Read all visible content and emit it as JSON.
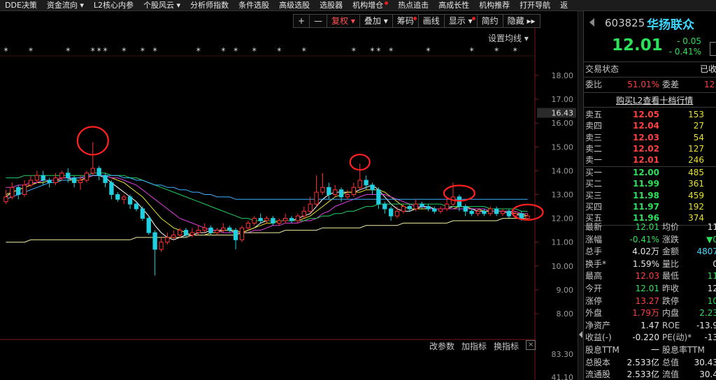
{
  "menu": [
    {
      "label": "DDE决策",
      "has_dropdown": false,
      "dot": false
    },
    {
      "label": "资金流向",
      "has_dropdown": true,
      "dot": false
    },
    {
      "label": "L2核心内参",
      "has_dropdown": false,
      "dot": false
    },
    {
      "label": "个股风云",
      "has_dropdown": true,
      "dot": false
    },
    {
      "label": "分析师指数",
      "has_dropdown": false,
      "dot": false
    },
    {
      "label": "条件选股",
      "has_dropdown": false,
      "dot": false
    },
    {
      "label": "高级选股",
      "has_dropdown": false,
      "dot": false
    },
    {
      "label": "选股器",
      "has_dropdown": false,
      "dot": false
    },
    {
      "label": "机构增仓",
      "has_dropdown": false,
      "dot": true
    },
    {
      "label": "热点追击",
      "has_dropdown": false,
      "dot": false
    },
    {
      "label": "高成长性",
      "has_dropdown": false,
      "dot": false
    },
    {
      "label": "机构推荐",
      "has_dropdown": false,
      "dot": false
    },
    {
      "label": "打开导航",
      "has_dropdown": false,
      "dot": false
    },
    {
      "label": "返",
      "has_dropdown": false,
      "dot": false
    }
  ],
  "toolbar": [
    {
      "label": "+",
      "active": false,
      "dot": false
    },
    {
      "label": "—",
      "active": false,
      "dot": false
    },
    {
      "label": "复权 ▾",
      "active": true,
      "dot": false
    },
    {
      "label": "叠加 ▾",
      "active": false,
      "dot": false
    },
    {
      "label": "筹码",
      "active": false,
      "dot": true
    },
    {
      "label": "画线",
      "active": false,
      "dot": false
    },
    {
      "label": "显示 ▾",
      "active": false,
      "dot": true
    },
    {
      "label": "简约",
      "active": false,
      "dot": false
    },
    {
      "label": "隐藏 ▸▸",
      "active": false,
      "dot": false
    }
  ],
  "ma_setting_label": "设置均线 ▾",
  "indicator_bar": {
    "params": "改参数",
    "add": "加指标",
    "switch": "换指标",
    "close": "×"
  },
  "chart_data": {
    "type": "candlestick",
    "y_ticks": [
      "18.00",
      "17.00",
      "16.00",
      "15.00",
      "14.00",
      "13.00",
      "12.00",
      "11.00",
      "10.00",
      "9.00",
      "8.00"
    ],
    "current_price_label": "16.43",
    "volume_ticks": [
      "83.30",
      "41.10"
    ],
    "ylim": [
      7.5,
      18.5
    ],
    "candles": [
      [
        12.7,
        12.9,
        13.2,
        12.6
      ],
      [
        12.9,
        13.3,
        13.5,
        12.8
      ],
      [
        13.3,
        13.0,
        13.4,
        12.8
      ],
      [
        13.0,
        13.4,
        13.6,
        12.9
      ],
      [
        13.4,
        13.6,
        13.8,
        13.3
      ],
      [
        13.6,
        13.8,
        14.0,
        13.5
      ],
      [
        13.8,
        13.6,
        14.0,
        13.4
      ],
      [
        13.6,
        13.5,
        13.7,
        13.3
      ],
      [
        13.5,
        13.7,
        13.9,
        13.4
      ],
      [
        13.7,
        13.9,
        14.0,
        13.6
      ],
      [
        13.9,
        13.7,
        14.1,
        13.5
      ],
      [
        13.7,
        13.5,
        13.8,
        13.3
      ],
      [
        13.5,
        13.6,
        13.8,
        13.2
      ],
      [
        13.6,
        13.9,
        14.0,
        13.5
      ],
      [
        13.9,
        14.1,
        15.2,
        13.8
      ],
      [
        14.1,
        13.8,
        14.2,
        13.6
      ],
      [
        13.8,
        13.5,
        13.9,
        13.3
      ],
      [
        13.5,
        13.0,
        13.6,
        12.8
      ],
      [
        13.0,
        12.8,
        13.1,
        12.7
      ],
      [
        12.8,
        12.9,
        13.0,
        12.6
      ],
      [
        12.9,
        12.6,
        13.0,
        12.4
      ],
      [
        12.6,
        12.4,
        12.7,
        12.3
      ],
      [
        12.4,
        12.0,
        12.5,
        11.9
      ],
      [
        12.0,
        11.4,
        12.1,
        11.3
      ],
      [
        11.4,
        10.7,
        11.5,
        9.6
      ],
      [
        10.7,
        11.0,
        11.2,
        10.6
      ],
      [
        11.0,
        11.2,
        11.4,
        10.9
      ],
      [
        11.2,
        11.3,
        11.5,
        11.1
      ],
      [
        11.3,
        11.5,
        11.6,
        11.2
      ],
      [
        11.5,
        11.3,
        11.6,
        11.2
      ],
      [
        11.3,
        11.4,
        11.6,
        11.2
      ],
      [
        11.4,
        11.5,
        11.7,
        11.3
      ],
      [
        11.5,
        11.6,
        11.8,
        11.4
      ],
      [
        11.6,
        11.4,
        11.7,
        11.3
      ],
      [
        11.4,
        11.5,
        11.6,
        11.3
      ],
      [
        11.5,
        11.6,
        11.8,
        11.4
      ],
      [
        11.6,
        11.5,
        11.7,
        11.4
      ],
      [
        11.5,
        11.1,
        11.6,
        10.7
      ],
      [
        11.1,
        11.6,
        11.7,
        11.0
      ],
      [
        11.6,
        11.8,
        11.9,
        11.5
      ],
      [
        11.8,
        12.0,
        12.1,
        11.7
      ],
      [
        12.0,
        11.9,
        12.2,
        11.8
      ],
      [
        11.9,
        12.0,
        12.1,
        11.8
      ],
      [
        12.0,
        11.8,
        12.1,
        11.7
      ],
      [
        11.8,
        11.9,
        12.0,
        11.7
      ],
      [
        11.9,
        12.0,
        12.2,
        11.8
      ],
      [
        12.0,
        11.9,
        12.1,
        11.8
      ],
      [
        11.9,
        12.1,
        12.2,
        11.8
      ],
      [
        12.1,
        12.3,
        12.5,
        12.0
      ],
      [
        12.3,
        12.6,
        12.9,
        12.2
      ],
      [
        12.6,
        13.1,
        13.8,
        12.5
      ],
      [
        13.1,
        13.3,
        13.9,
        13.0
      ],
      [
        13.3,
        13.0,
        13.5,
        12.8
      ],
      [
        13.0,
        13.2,
        13.4,
        12.9
      ],
      [
        13.2,
        12.9,
        13.3,
        12.7
      ],
      [
        12.9,
        13.0,
        13.2,
        12.8
      ],
      [
        13.0,
        13.3,
        13.5,
        12.9
      ],
      [
        13.3,
        13.6,
        14.3,
        13.2
      ],
      [
        13.6,
        13.4,
        13.8,
        13.2
      ],
      [
        13.4,
        13.2,
        13.5,
        13.0
      ],
      [
        13.2,
        12.6,
        13.3,
        12.4
      ],
      [
        12.6,
        12.4,
        12.7,
        12.2
      ],
      [
        12.4,
        12.1,
        12.5,
        11.9
      ],
      [
        12.1,
        12.3,
        12.5,
        12.0
      ],
      [
        12.3,
        12.5,
        12.6,
        12.2
      ],
      [
        12.5,
        12.4,
        12.6,
        12.3
      ],
      [
        12.4,
        12.6,
        12.8,
        12.3
      ],
      [
        12.6,
        12.5,
        12.7,
        12.4
      ],
      [
        12.5,
        12.4,
        12.6,
        12.3
      ],
      [
        12.4,
        12.3,
        12.5,
        12.2
      ],
      [
        12.3,
        12.4,
        12.5,
        12.2
      ],
      [
        12.4,
        12.6,
        12.9,
        12.3
      ],
      [
        12.6,
        12.9,
        13.5,
        12.5
      ],
      [
        12.9,
        12.5,
        13.0,
        12.3
      ],
      [
        12.5,
        12.3,
        12.6,
        12.1
      ],
      [
        12.3,
        12.2,
        12.4,
        12.1
      ],
      [
        12.2,
        12.3,
        12.4,
        12.1
      ],
      [
        12.3,
        12.2,
        12.4,
        12.1
      ],
      [
        12.2,
        12.4,
        12.5,
        12.1
      ],
      [
        12.4,
        12.2,
        12.5,
        12.1
      ],
      [
        12.2,
        12.3,
        12.4,
        12.1
      ],
      [
        12.3,
        12.1,
        12.4,
        12.0
      ],
      [
        12.1,
        12.2,
        12.3,
        12.0
      ],
      [
        12.2,
        12.0,
        12.3,
        11.9
      ],
      [
        12.0,
        12.1,
        12.2,
        11.95
      ]
    ],
    "ma_series": [
      {
        "color": "#ffffff",
        "values": [
          12.9,
          13.1,
          13.2,
          13.3,
          13.4,
          13.5,
          13.6,
          13.6,
          13.6,
          13.7,
          13.7,
          13.6,
          13.6,
          13.7,
          13.8,
          13.8,
          13.7,
          13.5,
          13.3,
          13.1,
          12.9,
          12.7,
          12.4,
          12.1,
          11.7,
          11.4,
          11.2,
          11.1,
          11.2,
          11.3,
          11.3,
          11.4,
          11.4,
          11.5,
          11.5,
          11.5,
          11.5,
          11.4,
          11.4,
          11.5,
          11.6,
          11.8,
          11.9,
          11.9,
          11.9,
          11.9,
          11.9,
          12.0,
          12.1,
          12.2,
          12.5,
          12.8,
          13.0,
          13.1,
          13.1,
          13.1,
          13.1,
          13.2,
          13.3,
          13.4,
          13.2,
          12.9,
          12.6,
          12.4,
          12.3,
          12.3,
          12.4,
          12.5,
          12.5,
          12.4,
          12.4,
          12.4,
          12.5,
          12.5,
          12.5,
          12.4,
          12.3,
          12.3,
          12.3,
          12.3,
          12.3,
          12.2,
          12.2,
          12.1,
          12.1
        ]
      },
      {
        "color": "#e8e030",
        "values": [
          13.0,
          13.1,
          13.2,
          13.3,
          13.4,
          13.5,
          13.5,
          13.6,
          13.6,
          13.6,
          13.6,
          13.6,
          13.6,
          13.7,
          13.8,
          13.8,
          13.8,
          13.7,
          13.6,
          13.5,
          13.3,
          13.1,
          12.9,
          12.6,
          12.3,
          12.0,
          11.8,
          11.6,
          11.5,
          11.4,
          11.3,
          11.3,
          11.3,
          11.4,
          11.4,
          11.5,
          11.5,
          11.5,
          11.4,
          11.5,
          11.6,
          11.7,
          11.8,
          11.8,
          11.9,
          11.9,
          11.9,
          11.9,
          12.0,
          12.1,
          12.3,
          12.5,
          12.7,
          12.9,
          13.0,
          13.1,
          13.1,
          13.1,
          13.2,
          13.2,
          13.2,
          13.1,
          12.9,
          12.7,
          12.5,
          12.4,
          12.4,
          12.4,
          12.4,
          12.4,
          12.4,
          12.4,
          12.4,
          12.5,
          12.5,
          12.4,
          12.4,
          12.3,
          12.3,
          12.3,
          12.3,
          12.3,
          12.2,
          12.2,
          12.1
        ]
      },
      {
        "color": "#e040e0",
        "values": [
          13.3,
          13.3,
          13.4,
          13.4,
          13.5,
          13.5,
          13.6,
          13.6,
          13.6,
          13.7,
          13.7,
          13.7,
          13.7,
          13.7,
          13.8,
          13.8,
          13.8,
          13.7,
          13.7,
          13.6,
          13.5,
          13.4,
          13.2,
          13.0,
          12.8,
          12.6,
          12.4,
          12.2,
          12.0,
          11.9,
          11.8,
          11.7,
          11.6,
          11.5,
          11.5,
          11.4,
          11.4,
          11.4,
          11.4,
          11.4,
          11.5,
          11.5,
          11.6,
          11.7,
          11.7,
          11.8,
          11.8,
          11.8,
          11.9,
          11.9,
          12.0,
          12.2,
          12.3,
          12.5,
          12.6,
          12.7,
          12.8,
          12.9,
          13.0,
          13.0,
          13.0,
          13.0,
          12.9,
          12.8,
          12.7,
          12.6,
          12.5,
          12.5,
          12.4,
          12.4,
          12.4,
          12.4,
          12.4,
          12.4,
          12.4,
          12.4,
          12.4,
          12.4,
          12.3,
          12.3,
          12.3,
          12.3,
          12.3,
          12.2,
          12.2
        ]
      },
      {
        "color": "#20d060",
        "values": [
          13.7,
          13.7,
          13.7,
          13.8,
          13.8,
          13.8,
          13.8,
          13.8,
          13.8,
          13.8,
          13.8,
          13.8,
          13.8,
          13.8,
          13.9,
          13.9,
          13.9,
          13.8,
          13.8,
          13.8,
          13.7,
          13.7,
          13.6,
          13.5,
          13.4,
          13.3,
          13.2,
          13.1,
          13.0,
          12.9,
          12.8,
          12.7,
          12.6,
          12.5,
          12.4,
          12.3,
          12.2,
          12.1,
          12.0,
          12.0,
          11.9,
          11.9,
          11.9,
          11.9,
          11.9,
          11.9,
          11.9,
          11.9,
          11.9,
          12.0,
          12.0,
          12.1,
          12.1,
          12.2,
          12.2,
          12.3,
          12.3,
          12.4,
          12.5,
          12.5,
          12.6,
          12.6,
          12.6,
          12.6,
          12.6,
          12.6,
          12.6,
          12.6,
          12.6,
          12.6,
          12.6,
          12.5,
          12.5,
          12.5,
          12.5,
          12.5,
          12.5,
          12.5,
          12.4,
          12.4,
          12.4,
          12.4,
          12.4,
          12.3,
          12.3
        ]
      },
      {
        "color": "#3fb0ff",
        "values": [
          12.8,
          12.9,
          13.0,
          13.1,
          13.2,
          13.3,
          13.4,
          13.5,
          13.5,
          13.6,
          13.6,
          13.7,
          13.7,
          13.8,
          13.8,
          13.8,
          13.8,
          13.8,
          13.8,
          13.7,
          13.7,
          13.6,
          13.6,
          13.5,
          13.4,
          13.4,
          13.3,
          13.3,
          13.2,
          13.2,
          13.1,
          13.1,
          13.0,
          13.0,
          12.9,
          12.9,
          12.9,
          12.8,
          12.8,
          12.8,
          12.8,
          12.8,
          12.8,
          12.8,
          12.8,
          12.8,
          12.8,
          12.8,
          12.8,
          12.8,
          12.8,
          12.8,
          12.8,
          12.8,
          12.8,
          12.8,
          12.8,
          12.8,
          12.8,
          12.8,
          12.8,
          12.8,
          12.8,
          12.8,
          12.8,
          12.8,
          12.8,
          12.8,
          12.8,
          12.8,
          12.8,
          12.8,
          12.8,
          12.8,
          12.8,
          12.8,
          12.8,
          12.8,
          12.8,
          12.8,
          12.8,
          12.8,
          12.8,
          12.8,
          12.8
        ]
      },
      {
        "color": "#f0f0a0",
        "values": [
          11.0,
          11.0,
          11.0,
          11.0,
          11.1,
          11.1,
          11.1,
          11.1,
          11.1,
          11.1,
          11.1,
          11.1,
          11.1,
          11.1,
          11.1,
          11.1,
          11.1,
          11.1,
          11.1,
          11.1,
          11.1,
          11.2,
          11.2,
          11.2,
          11.2,
          11.2,
          11.2,
          11.2,
          11.2,
          11.2,
          11.3,
          11.3,
          11.3,
          11.3,
          11.3,
          11.3,
          11.3,
          11.3,
          11.4,
          11.4,
          11.4,
          11.4,
          11.4,
          11.4,
          11.4,
          11.5,
          11.5,
          11.5,
          11.5,
          11.5,
          11.5,
          11.6,
          11.6,
          11.6,
          11.6,
          11.6,
          11.6,
          11.6,
          11.7,
          11.7,
          11.7,
          11.7,
          11.7,
          11.7,
          11.8,
          11.8,
          11.8,
          11.8,
          11.8,
          11.8,
          11.8,
          11.8,
          11.9,
          11.9,
          11.9,
          11.9,
          11.9,
          11.9,
          11.9,
          11.9,
          12.0,
          12.0,
          12.0,
          12.0,
          12.0
        ]
      }
    ],
    "marker_glyphs": "*",
    "marker_candle_indices": [
      0,
      4,
      10,
      14,
      15,
      16,
      19,
      22,
      24,
      31,
      35,
      37,
      40,
      44,
      48,
      56,
      59,
      60,
      62,
      68,
      75,
      79,
      82
    ],
    "circled_candle_indices": [
      14,
      57,
      73,
      84
    ]
  },
  "quote": {
    "code": "603825",
    "name": "华扬联众",
    "price": "12.01",
    "change": "- 0.05",
    "change_pct": "- 0.41%",
    "status_label": "交易状态",
    "status_value": "已收",
    "weibi_label": "委比",
    "weibi_value": "51.01%",
    "weicha_label": "委差",
    "weicha_value": "12",
    "l2_link": "购买L2查看十档行情",
    "sells": [
      [
        "卖五",
        "12.05",
        "153"
      ],
      [
        "卖四",
        "12.04",
        "27"
      ],
      [
        "卖三",
        "12.03",
        "54"
      ],
      [
        "卖二",
        "12.02",
        "127"
      ],
      [
        "卖一",
        "12.01",
        "246"
      ]
    ],
    "buys": [
      [
        "买一",
        "12.00",
        "485"
      ],
      [
        "买二",
        "11.99",
        "361"
      ],
      [
        "买三",
        "11.98",
        "459"
      ],
      [
        "买四",
        "11.97",
        "192"
      ],
      [
        "买五",
        "11.96",
        "374"
      ]
    ],
    "stats": [
      [
        "最新",
        "12.01",
        "green",
        "均价",
        "11",
        "white"
      ],
      [
        "涨幅",
        "-0.41%",
        "green",
        "涨跌",
        "▼0",
        "green"
      ],
      [
        "总手",
        "4.02万",
        "white",
        "金额",
        "4807",
        "cyan"
      ],
      [
        "换手*",
        "1.59%",
        "white",
        "量比",
        "0",
        "white"
      ],
      [
        "最高",
        "12.03",
        "red",
        "最低",
        "11",
        "green"
      ],
      [
        "今开",
        "12.01",
        "green",
        "昨收",
        "12",
        "white"
      ],
      [
        "涨停",
        "13.27",
        "red",
        "跌停",
        "10",
        "green"
      ],
      [
        "外盘",
        "1.79万",
        "red",
        "内盘",
        "2.23",
        "green"
      ],
      [
        "净资产",
        "1.47",
        "white",
        "ROE",
        "-13.9",
        "white"
      ],
      [
        "收益(-)",
        "-0.220",
        "white",
        "PE(动)*",
        "-13",
        "white"
      ],
      [
        "股息TTM",
        "一",
        "white",
        "股息率TTM",
        "",
        "white"
      ],
      [
        "总股本",
        "2.533亿",
        "white",
        "总值",
        "30.43",
        "white"
      ],
      [
        "流通股",
        "2.533亿",
        "white",
        "流值",
        "30.4",
        "white"
      ]
    ]
  }
}
